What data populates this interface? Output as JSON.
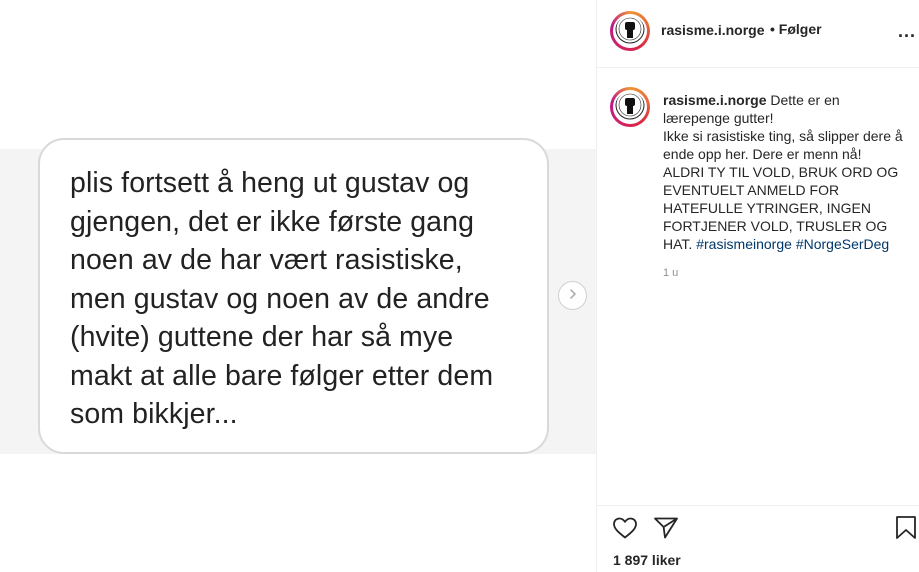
{
  "post": {
    "image_text": "plis fortsett å heng ut gustav og\ngjengen, det er ikke første gang\nnoen av de har vært rasistiske,\nmen gustav og noen av de andre\n(hvite) guttene der har så mye\nmakt at alle bare følger etter dem\nsom bikkjer..."
  },
  "header": {
    "username": "rasisme.i.norge",
    "follow_label": "• Følger",
    "more_label": "..."
  },
  "caption": {
    "username": "rasisme.i.norge",
    "text_1": "Dette er en lærepenge gutter!",
    "text_2": "Ikke si rasistiske ting, så slipper dere å ende opp her. Dere er menn nå!",
    "text_3": "ALDRI TY TIL VOLD, BRUK ORD OG EVENTUELT ANMELD FOR HATEFULLE YTRINGER, INGEN FORTJENER VOLD, TRUSLER OG HAT.",
    "hashtag_1": "#rasismeinorge",
    "hashtag_2": "#NorgeSerDeg",
    "time": "1 u"
  },
  "actions": {
    "likes": "1 897 liker"
  },
  "icons": {
    "next": "chevron-right-icon",
    "like": "heart-icon",
    "share": "paper-plane-icon",
    "save": "bookmark-icon",
    "more": "ellipsis-icon",
    "avatar": "raised-fist-icon"
  },
  "colors": {
    "hashtag": "#00376b",
    "muted": "#8e8e8e",
    "text": "#262626"
  }
}
